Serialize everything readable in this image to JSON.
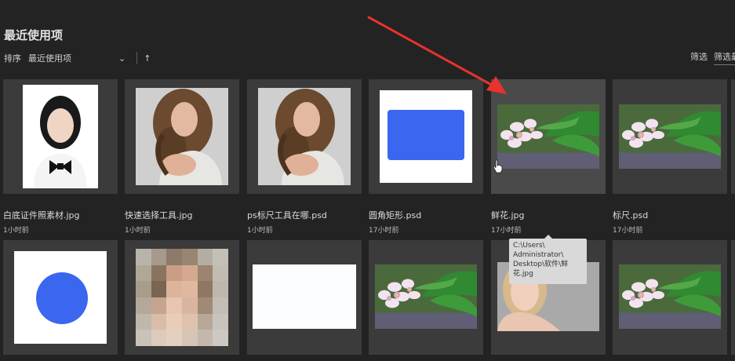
{
  "page": {
    "title": "最近使用项"
  },
  "sort": {
    "label": "排序",
    "value": "最近使用项",
    "direction_icon": "arrow-up-icon"
  },
  "filter": {
    "label": "筛选",
    "placeholder": "筛选最"
  },
  "files": [
    {
      "name": "白底证件照素材.jpg",
      "time": "1小时前"
    },
    {
      "name": "快速选择工具.jpg",
      "time": "1小时前"
    },
    {
      "name": "ps标尺工具在哪.psd",
      "time": "1小时前"
    },
    {
      "name": "圆角矩形.psd",
      "time": "17小时前"
    },
    {
      "name": "鲜花.jpg",
      "time": "17小时前"
    },
    {
      "name": "标尺.psd",
      "time": "17小时前"
    }
  ],
  "tooltip": {
    "lines": [
      "C:\\Users\\",
      "Administrator\\",
      "Desktop\\软件\\鲜",
      "花.jpg"
    ]
  },
  "colors": {
    "background": "#232323",
    "card": "#3b3b3b",
    "accent_blue": "#3a66f0",
    "arrow_red": "#e8322d"
  }
}
